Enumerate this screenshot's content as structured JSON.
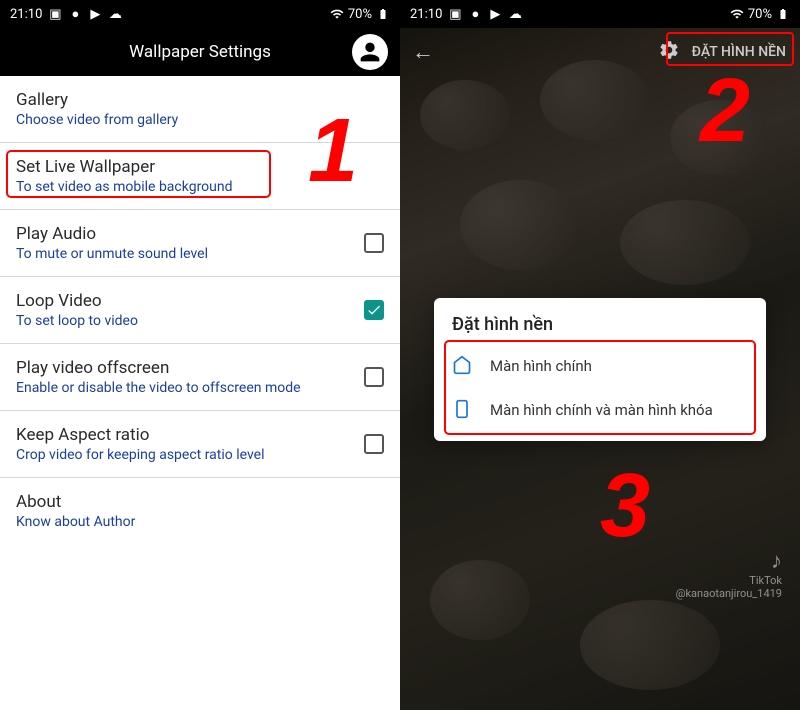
{
  "status": {
    "time": "21:10",
    "battery": "70%"
  },
  "left": {
    "headerTitle": "Wallpaper Settings",
    "items": {
      "gallery": {
        "title": "Gallery",
        "sub": "Choose video from gallery"
      },
      "setLive": {
        "title": "Set Live Wallpaper",
        "sub": "To set video as mobile background"
      },
      "playAudio": {
        "title": "Play Audio",
        "sub": "To mute or unmute sound level"
      },
      "loopVideo": {
        "title": "Loop Video",
        "sub": "To set loop to video"
      },
      "offscreen": {
        "title": "Play video offscreen",
        "sub": "Enable or disable the video to offscreen mode"
      },
      "aspect": {
        "title": "Keep Aspect ratio",
        "sub": "Crop video for keeping aspect ratio level"
      },
      "about": {
        "title": "About",
        "sub": "Know about Author"
      }
    }
  },
  "right": {
    "setButton": "ĐẶT HÌNH NỀN",
    "dialog": {
      "title": "Đặt hình nền",
      "option1": "Màn hình chính",
      "option2": "Màn hình chính và màn hình khóa"
    },
    "tiktok": {
      "brand": "TikTok",
      "handle": "@kanaotanjirou_1419"
    }
  },
  "annotations": {
    "n1": "1",
    "n2": "2",
    "n3": "3"
  }
}
